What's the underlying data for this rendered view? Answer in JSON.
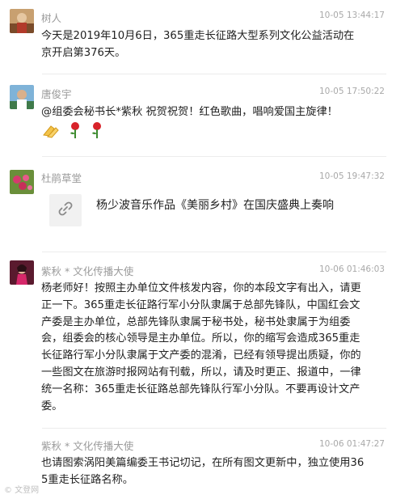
{
  "posts": [
    {
      "author": "树人",
      "time": "10-05 13:44:17",
      "text": "今天是2019年10月6日，365重走长征路大型系列文化公益活动在京开启第376天。"
    },
    {
      "author": "唐俊宇",
      "time": "10-05 17:50:22",
      "text": "@组委会秘书长*紫秋 祝贺祝贺！红色歌曲，唱响爱国主旋律！",
      "emojis": [
        "clap-hands-icon",
        "rose-icon",
        "rose-icon"
      ]
    },
    {
      "author": "杜鹃草堂",
      "time": "10-05 19:47:32",
      "link_title": "杨少波音乐作品《美丽乡村》在国庆盛典上奏响",
      "link_icon": "link-icon"
    },
    {
      "author": "紫秋 * 文化传播大使",
      "time": "10-06 01:46:03",
      "text": "杨老师好！按照主办单位文件核发内容，你的本段文字有出入，请更正一下。365重走长征路行军小分队隶属于总部先锋队，中国红会文产委是主办单位，总部先锋队隶属于秘书处，秘书处隶属于为组委会，组委会的核心领导是主办单位。所以，你的缩写会造成365重走长征路行军小分队隶属于文产委的混淆，已经有领导提出质疑，你的一些图文在旅游时报网站有刊载，所以，请及时更正、报道中，一律统一名称：365重走长征路总部先锋队行军小分队。不要再设计文产委。"
    },
    {
      "author": "紫秋 * 文化传播大使",
      "time": "10-06 01:47:27",
      "text": "也请图索涡阳美篇编委王书记切记，在所有图文更新中，独立使用365重走长征路名称。"
    }
  ],
  "watermark": "© 文登网",
  "colors": {
    "name": "#9b9b9b",
    "time": "#a9a9a9",
    "text": "#222222",
    "separator": "#ececec"
  }
}
